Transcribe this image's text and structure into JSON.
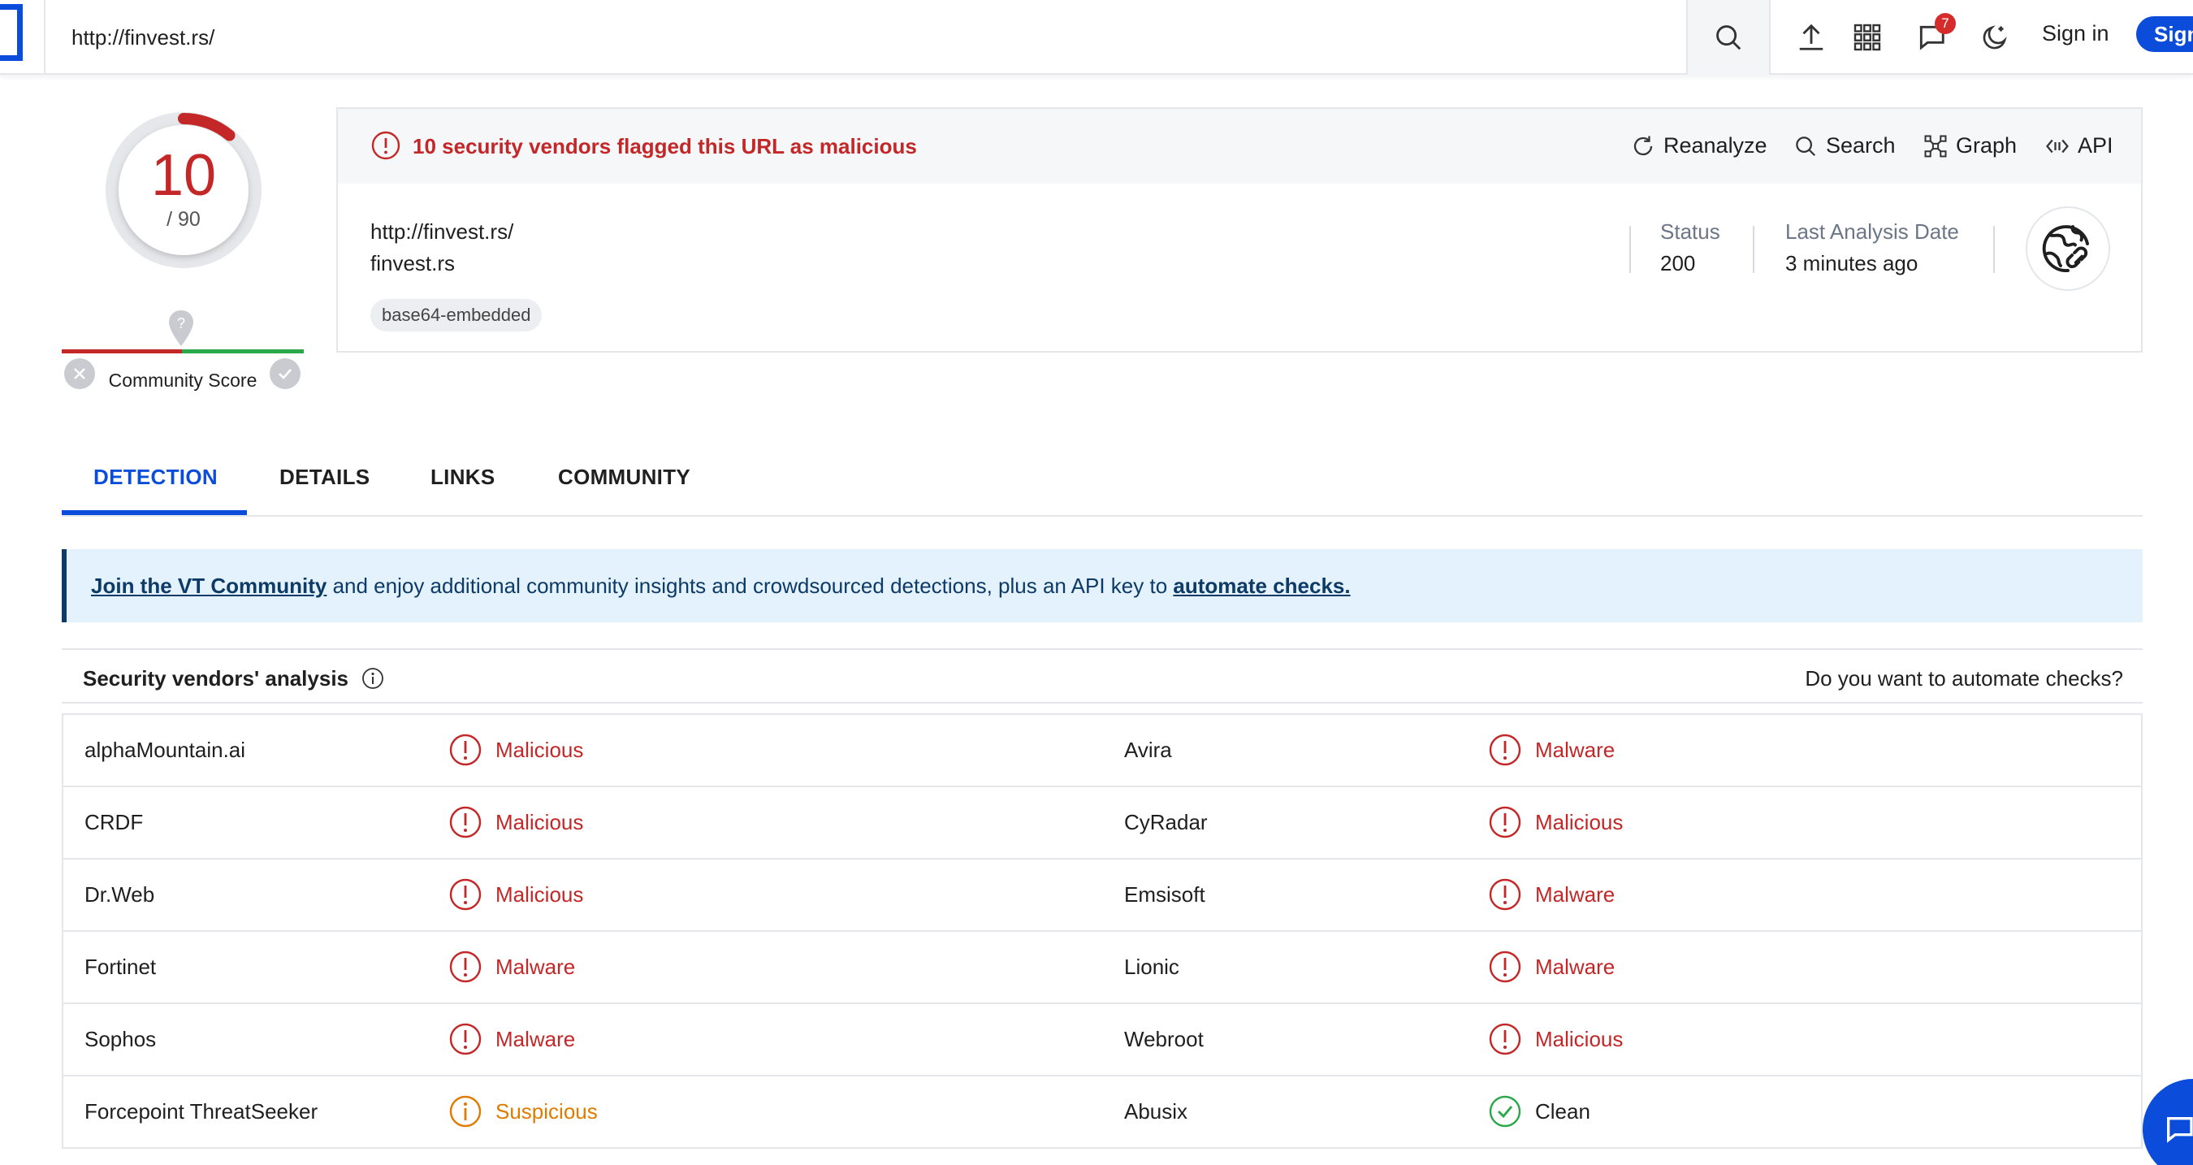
{
  "header": {
    "url_value": "http://finvest.rs/",
    "notifications_count": "7",
    "signin_label": "Sign in",
    "signup_label": "Sign"
  },
  "score": {
    "detections": "10",
    "total": "/ 90",
    "flagged_fraction": 0.111,
    "community_score_label": "Community Score"
  },
  "summary": {
    "alert": "10 security vendors flagged this URL as malicious",
    "actions": {
      "reanalyze": "Reanalyze",
      "search": "Search",
      "graph": "Graph",
      "api": "API"
    },
    "url": "http://finvest.rs/",
    "domain": "finvest.rs",
    "tag": "base64-embedded",
    "status_label": "Status",
    "status_value": "200",
    "last_analysis_label": "Last Analysis Date",
    "last_analysis_value": "3 minutes ago"
  },
  "tabs": [
    "DETECTION",
    "DETAILS",
    "LINKS",
    "COMMUNITY"
  ],
  "banner": {
    "link1": "Join the VT Community",
    "middle": " and enjoy additional community insights and crowdsourced detections, plus an API key to ",
    "link2": "automate checks."
  },
  "vendors": {
    "title": "Security vendors' analysis",
    "automate_prompt": "Do you want to automate checks?",
    "rows": [
      {
        "left_vendor": "alphaMountain.ai",
        "left_result": "Malicious",
        "right_vendor": "Avira",
        "right_result": "Malware"
      },
      {
        "left_vendor": "CRDF",
        "left_result": "Malicious",
        "right_vendor": "CyRadar",
        "right_result": "Malicious"
      },
      {
        "left_vendor": "Dr.Web",
        "left_result": "Malicious",
        "right_vendor": "Emsisoft",
        "right_result": "Malware"
      },
      {
        "left_vendor": "Fortinet",
        "left_result": "Malware",
        "right_vendor": "Lionic",
        "right_result": "Malware"
      },
      {
        "left_vendor": "Sophos",
        "left_result": "Malware",
        "right_vendor": "Webroot",
        "right_result": "Malicious"
      },
      {
        "left_vendor": "Forcepoint ThreatSeeker",
        "left_result": "Suspicious",
        "right_vendor": "Abusix",
        "right_result": "Clean"
      }
    ]
  },
  "colors": {
    "accent": "#0b4dda",
    "malicious": "#c32727",
    "suspicious": "#e07b00",
    "clean": "#2ba84a"
  }
}
